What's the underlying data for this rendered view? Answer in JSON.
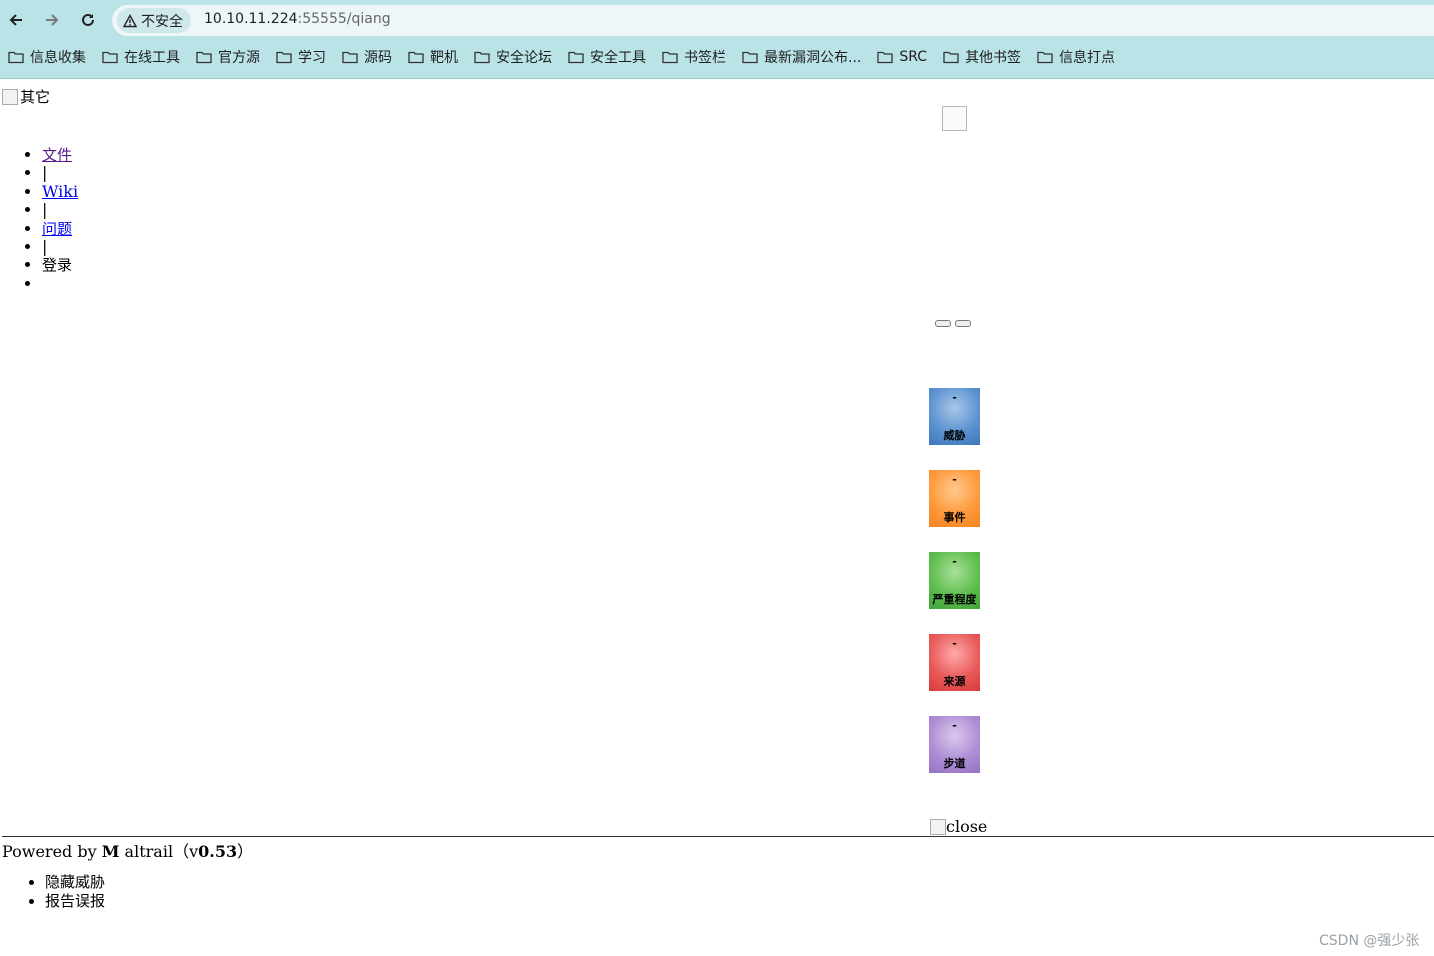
{
  "browser": {
    "security_label": "不安全",
    "url_host": "10.10.11.224",
    "url_path": ":55555/qiang",
    "bookmarks": [
      "信息收集",
      "在线工具",
      "官方源",
      "学习",
      "源码",
      "靶机",
      "安全论坛",
      "安全工具",
      "书签栏",
      "最新漏洞公布...",
      "SRC",
      "其他书签",
      "信息打点"
    ]
  },
  "header": {
    "logo_alt": "其它"
  },
  "nav": {
    "files": "文件",
    "sep1": "|",
    "wiki": "Wiki",
    "sep2": "|",
    "issues": "问题",
    "sep3": "|",
    "login": "登录"
  },
  "stats": {
    "threats": {
      "value": "-",
      "label": "威胁"
    },
    "events": {
      "value": "-",
      "label": "事件"
    },
    "severity": {
      "value": "-",
      "label": "严重程度"
    },
    "sources": {
      "value": "-",
      "label": "来源"
    },
    "trails": {
      "value": "-",
      "label": "步道"
    }
  },
  "close_alt": "close",
  "footer": {
    "prefix": "Powered by ",
    "brand_bold": "M",
    "brand_rest": "altrail",
    "open": "（",
    "v": "v",
    "version": "0.53",
    "close": "）"
  },
  "context_menu": [
    "隐藏威胁",
    "报告误报"
  ],
  "watermark": "CSDN @强少张",
  "colors": {
    "chrome": "#b9e3e6",
    "link": "#0000ee",
    "visited": "#551a8b"
  },
  "icons": [
    "back-arrow-icon",
    "forward-arrow-icon",
    "reload-icon",
    "warning-icon",
    "folder-icon"
  ]
}
